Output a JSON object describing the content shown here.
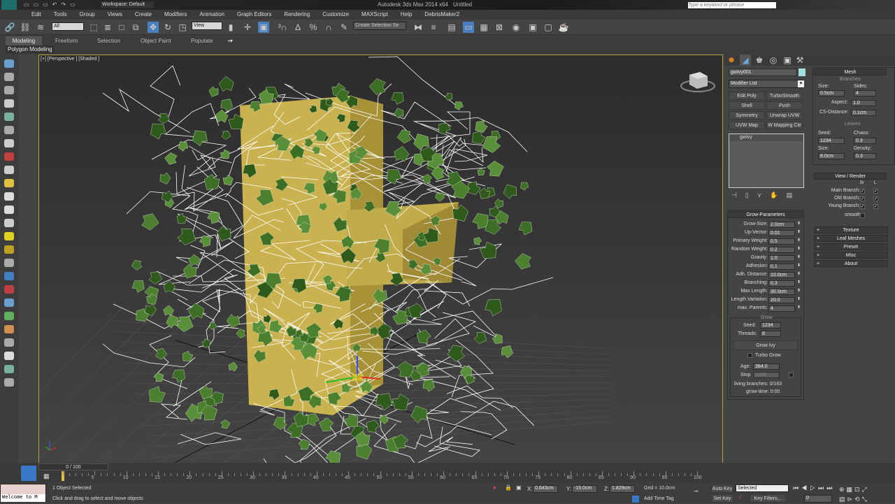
{
  "titlebar": {
    "workspace": "Workspace: Default",
    "title": "Autodesk 3ds Max 2014 x64",
    "doc": "Untitled",
    "search_placeholder": "Type a keyword or phrase"
  },
  "menu": [
    "Edit",
    "Tools",
    "Group",
    "Views",
    "Create",
    "Modifiers",
    "Animation",
    "Graph Editors",
    "Rendering",
    "Customize",
    "MAXScript",
    "Help",
    "DebrisMaker2"
  ],
  "toolbar": {
    "filter": "All",
    "ref_coord": "View",
    "selection_set": "Create Selection Se"
  },
  "ribbon": {
    "tabs": [
      "Modeling",
      "Freeform",
      "Selection",
      "Object Paint",
      "Populate"
    ],
    "panel": "Polygon Modeling"
  },
  "viewport": {
    "label": "[+] [Perspective ] [Shaded ]"
  },
  "cmd": {
    "object_name": "gwIvy001",
    "object_color": "#a0e0e0",
    "modifier_list": "Modifier List",
    "modifier_buttons": [
      "Edit Poly",
      "TurboSmooth",
      "Shell",
      "Push",
      "Symmetry",
      "Unwrap UVW",
      "UVW Map",
      "W Mapping Cle"
    ],
    "stack": [
      "gwIvy"
    ],
    "mesh": {
      "title": "Mesh",
      "branches_title": "Branches",
      "size_label": "Size:",
      "size": "0.5cm",
      "sides_label": "Sides:",
      "sides": "4",
      "aspect_label": "Aspect:",
      "aspect": "1.0",
      "cs_label": "CS-Distance:",
      "cs": "0.1cm",
      "leaves_title": "Leaves",
      "seed_label": "Seed:",
      "seed": "1234",
      "chaos_label": "Chaos:",
      "chaos": "0.3",
      "lsize_label": "Size:",
      "lsize": "8.0cm",
      "density_label": "Density:",
      "density": "0.3"
    },
    "view_render": {
      "title": "View / Render",
      "col_br": "Br",
      "col_l": "L",
      "rows": [
        "Main Branch:",
        "Old Branch:",
        "Young Branch:"
      ],
      "smooth": "smooth:"
    },
    "rollouts": [
      "Texture",
      "Leaf Meshes",
      "Preset",
      "Misc",
      "About"
    ],
    "grow": {
      "title": "Grow-Parameters",
      "params": [
        [
          "Grow-Size:",
          "2.0cm"
        ],
        [
          "Up-Vector:",
          "0.01"
        ],
        [
          "Primary Weight:",
          "0.5"
        ],
        [
          "Random Weight:",
          "0.2"
        ],
        [
          "Gravity:",
          "1.0"
        ],
        [
          "Adhesion:",
          "0.1"
        ],
        [
          "Adh. Distance:",
          "10.0cm"
        ],
        [
          "Branching:",
          "0.3"
        ],
        [
          "Max Length:",
          "30.0cm"
        ],
        [
          "Length Variation:",
          "20.0"
        ],
        [
          "max. Parents:",
          "4"
        ]
      ],
      "group": "Grow",
      "seed_label": "Seed:",
      "seed": "1234",
      "threads_label": "Threads:",
      "threads": "8",
      "grow_btn": "Grow Ivy",
      "turbo": "Turbo Grow",
      "age_label": "Age:",
      "age": "384.0",
      "stop_label": "Stop",
      "stop": "1000",
      "living": "living branches: 0/163",
      "growtime": "grow-time: 0:00"
    }
  },
  "timeline": {
    "frame": "0 / 100",
    "ticks": [
      "5",
      "10",
      "15",
      "20",
      "25",
      "30",
      "35",
      "40",
      "45",
      "50",
      "55",
      "60",
      "65",
      "70",
      "75",
      "80",
      "85",
      "90",
      "95",
      "100"
    ]
  },
  "status": {
    "welcome": "Welcome to M",
    "selected": "1 Object Selected",
    "prompt": "Click and drag to select and move objects",
    "x_label": "X:",
    "x": "0.643cm",
    "y_label": "Y:",
    "y": "-15.0cm",
    "z_label": "Z:",
    "z": "1.829cm",
    "grid": "Grid = 10.0cm",
    "autokey": "Auto Key",
    "setkey": "Set Key",
    "keymode": "Selected",
    "keyfilters": "Key Filters...",
    "addtimetag": "Add Time Tag",
    "curframe": "0"
  }
}
